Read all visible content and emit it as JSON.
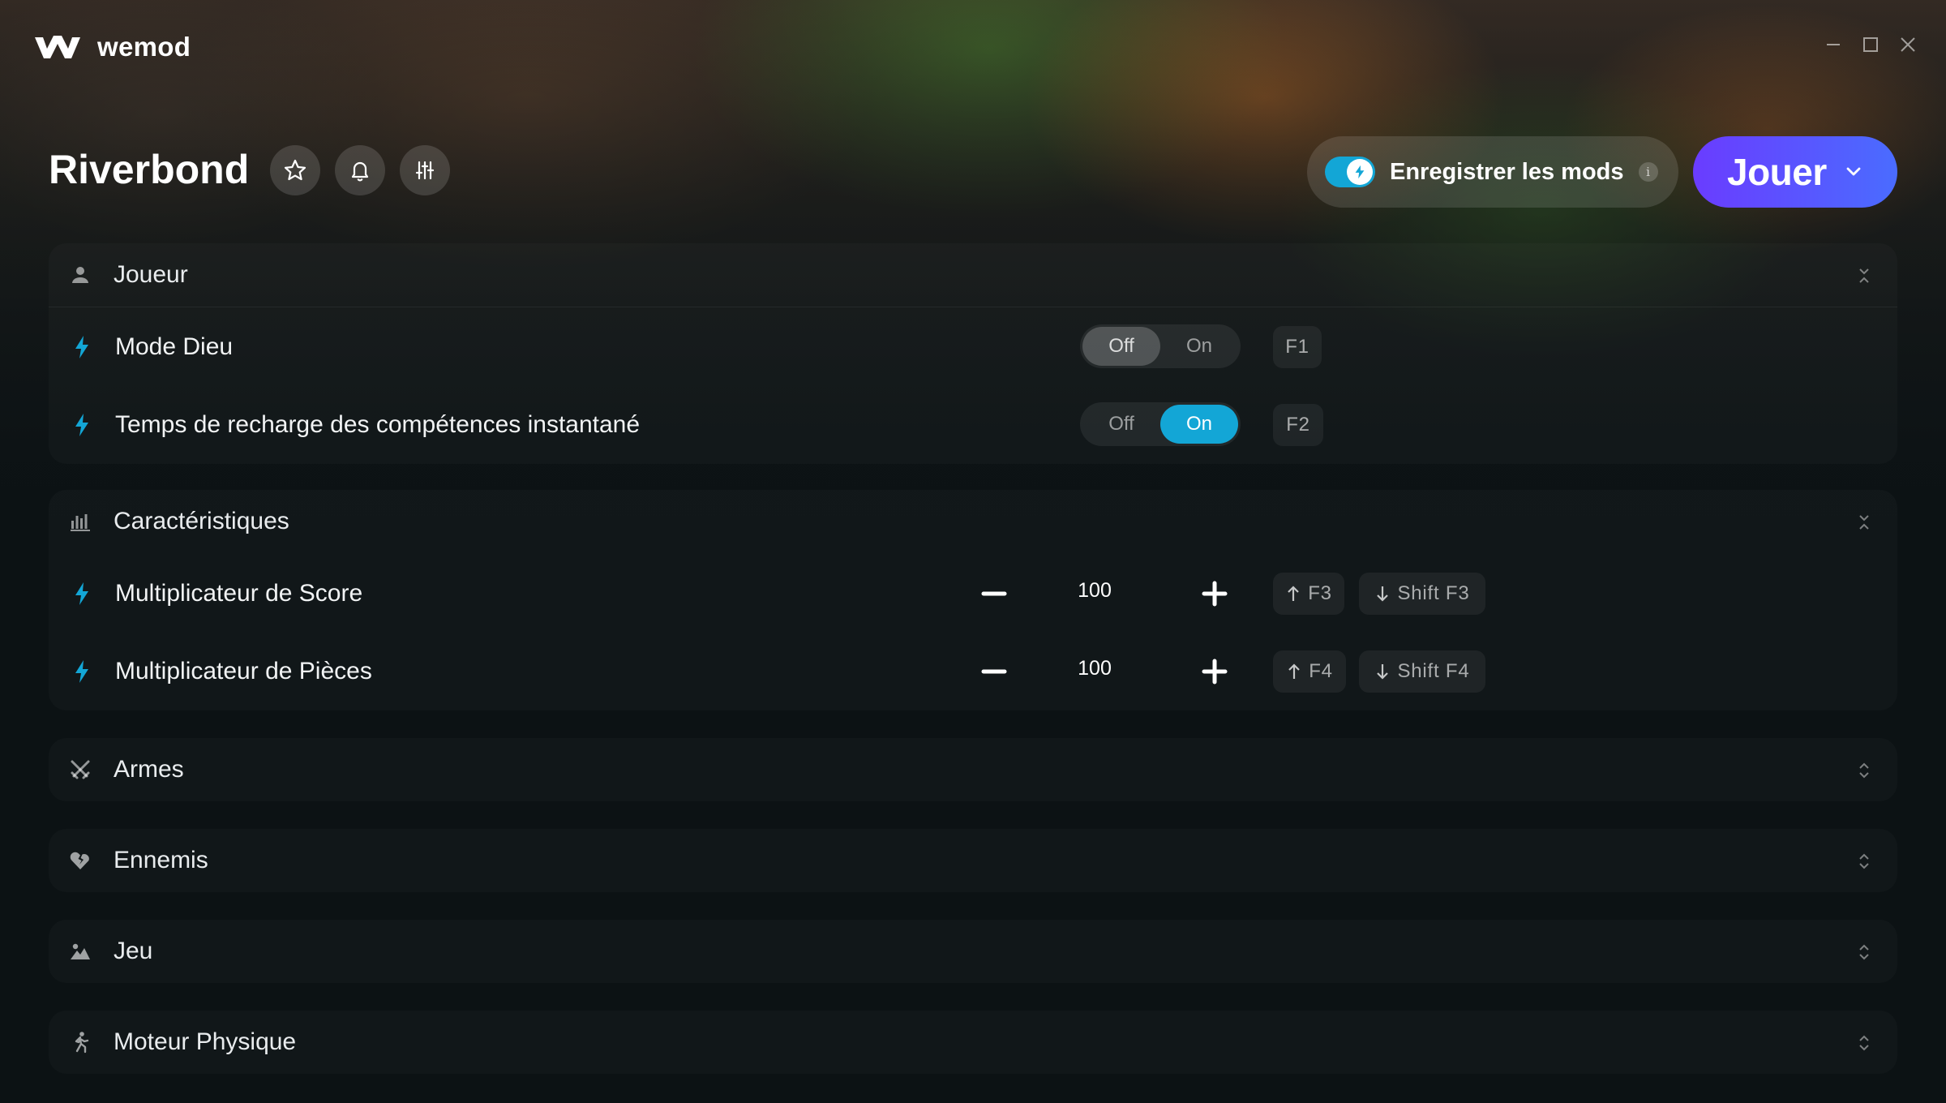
{
  "app": {
    "brand": "wemod",
    "window_controls": [
      "minimize-icon",
      "maximize-icon",
      "close-icon"
    ]
  },
  "game": {
    "title": "Riverbond",
    "header_icons": [
      "star-icon",
      "bell-icon",
      "sliders-icon"
    ]
  },
  "save_mods": {
    "label": "Enregistrer les mods",
    "enabled": true,
    "info": "i"
  },
  "play": {
    "label": "Jouer"
  },
  "categories": [
    {
      "label": "Joueur",
      "icon": "user-icon",
      "expanded": true,
      "mods": [
        {
          "label": "Mode Dieu",
          "type": "toggle",
          "off": "Off",
          "on": "On",
          "state": "Off",
          "key": "F1"
        },
        {
          "label": "Temps de recharge des compétences instantané",
          "type": "toggle",
          "off": "Off",
          "on": "On",
          "state": "On",
          "key": "F2"
        }
      ]
    },
    {
      "label": "Caractéristiques",
      "icon": "bar-chart-icon",
      "expanded": true,
      "mods": [
        {
          "label": "Multiplicateur de Score",
          "type": "stepper",
          "value": "100",
          "key_up": "F3",
          "key_down": "Shift F3"
        },
        {
          "label": "Multiplicateur de Pièces",
          "type": "stepper",
          "value": "100",
          "key_up": "F4",
          "key_down": "Shift F4"
        }
      ]
    },
    {
      "label": "Armes",
      "icon": "swords-icon",
      "expanded": false
    },
    {
      "label": "Ennemis",
      "icon": "broken-heart-icon",
      "expanded": false
    },
    {
      "label": "Jeu",
      "icon": "landscape-icon",
      "expanded": false
    },
    {
      "label": "Moteur Physique",
      "icon": "running-person-icon",
      "expanded": false
    }
  ],
  "colors": {
    "accent": "#13a6d6",
    "play_gradient_start": "#6a3cff",
    "play_gradient_end": "#4a6cff",
    "background": "#0c1214"
  }
}
